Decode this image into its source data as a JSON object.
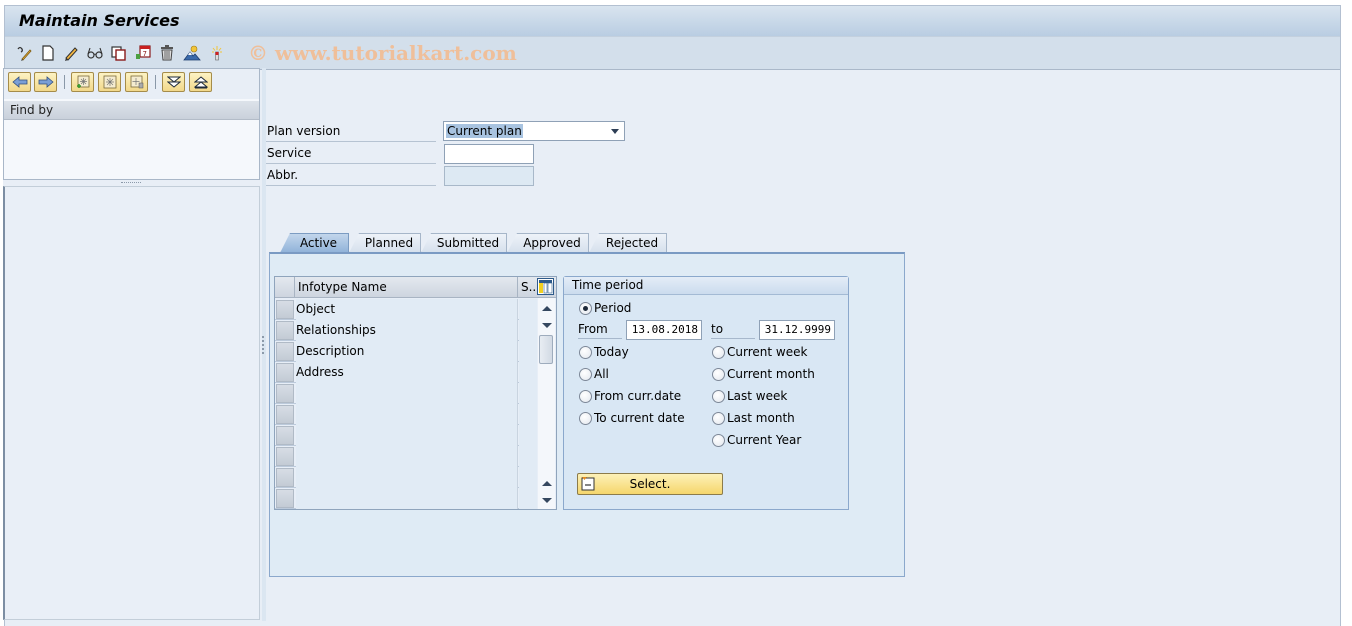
{
  "window": {
    "title": "Maintain Services",
    "watermark": "© www.tutorialkart.com"
  },
  "toolbar": {
    "icons": [
      {
        "name": "other-object-icon",
        "tooltip": "Other object"
      },
      {
        "name": "create-icon",
        "tooltip": "Create"
      },
      {
        "name": "change-icon",
        "tooltip": "Change"
      },
      {
        "name": "display-icon",
        "tooltip": "Display"
      },
      {
        "name": "copy-icon",
        "tooltip": "Copy"
      },
      {
        "name": "delimit-icon",
        "tooltip": "Delimit"
      },
      {
        "name": "delete-icon",
        "tooltip": "Delete"
      },
      {
        "name": "overview-icon",
        "tooltip": "Overview"
      },
      {
        "name": "highlight-icon",
        "tooltip": "Highlight"
      }
    ]
  },
  "left_panel": {
    "nav_buttons": [
      "back",
      "forward",
      "create-search",
      "search",
      "delete-search",
      "expand",
      "collapse"
    ],
    "find_by_label": "Find by"
  },
  "form": {
    "plan_version_label": "Plan version",
    "plan_version_value": "Current plan",
    "service_label": "Service",
    "service_value": "",
    "abbr_label": "Abbr.",
    "abbr_value": ""
  },
  "tabs": [
    {
      "label": "Active",
      "active": true
    },
    {
      "label": "Planned",
      "active": false
    },
    {
      "label": "Submitted",
      "active": false
    },
    {
      "label": "Approved",
      "active": false
    },
    {
      "label": "Rejected",
      "active": false
    }
  ],
  "infotype_table": {
    "columns": [
      "Infotype Name",
      "S.."
    ],
    "rows": [
      {
        "name": "Object",
        "s": ""
      },
      {
        "name": "Relationships",
        "s": ""
      },
      {
        "name": "Description",
        "s": ""
      },
      {
        "name": "Address",
        "s": ""
      },
      {
        "name": "",
        "s": ""
      },
      {
        "name": "",
        "s": ""
      },
      {
        "name": "",
        "s": ""
      },
      {
        "name": "",
        "s": ""
      },
      {
        "name": "",
        "s": ""
      },
      {
        "name": "",
        "s": ""
      }
    ]
  },
  "time_period": {
    "title": "Time period",
    "period_label": "Period",
    "from_label": "From",
    "from_value": "13.08.2018",
    "to_label": "to",
    "to_value": "31.12.9999",
    "left_options": [
      "Today",
      "All",
      "From curr.date",
      "To current date"
    ],
    "right_options": [
      "Current week",
      "Current month",
      "Last week",
      "Last month",
      "Current Year"
    ],
    "selected": "Period",
    "select_button": "Select."
  }
}
